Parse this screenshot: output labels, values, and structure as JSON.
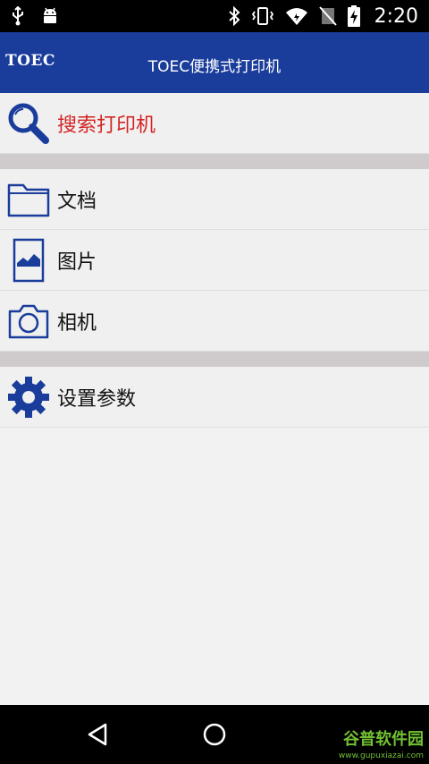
{
  "status_bar": {
    "time": "2:20",
    "left_icons": [
      "usb-icon",
      "android-icon"
    ],
    "right_icons": [
      "bluetooth-icon",
      "vibrate-icon",
      "wifi-icon",
      "no-sim-icon",
      "battery-charging-icon"
    ]
  },
  "app_bar": {
    "logo": "TOEC",
    "title": "TOEC便携式打印机",
    "color": "#1a3d9c"
  },
  "menu": {
    "search_label": "搜索打印机",
    "document_label": "文档",
    "picture_label": "图片",
    "camera_label": "相机",
    "settings_label": "设置参数"
  },
  "colors": {
    "search_text": "#d22424",
    "icon": "#1a3d9c",
    "divider": "#cfcacb"
  },
  "nav_bar": {
    "watermark": "谷普软件园",
    "watermark_url": "www.gupuxiazai.com"
  }
}
